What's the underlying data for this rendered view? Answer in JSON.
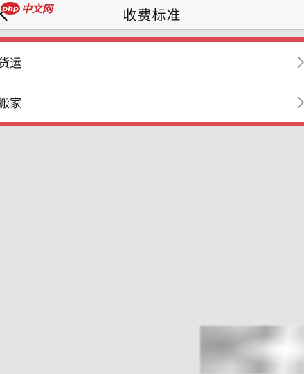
{
  "header": {
    "title": "收费标准",
    "back_icon": "chevron-left-icon"
  },
  "watermark": {
    "logo_text": "php",
    "site_text": "中文网"
  },
  "list": {
    "items": [
      {
        "label": "货运",
        "icon": "chevron-right-icon"
      },
      {
        "label": "搬家",
        "icon": "chevron-right-icon"
      }
    ]
  },
  "colors": {
    "highlight": "#dc4a50",
    "background": "#e4e4e4",
    "nav_bar": "#f7f7f7",
    "watermark": "#d0262b"
  }
}
